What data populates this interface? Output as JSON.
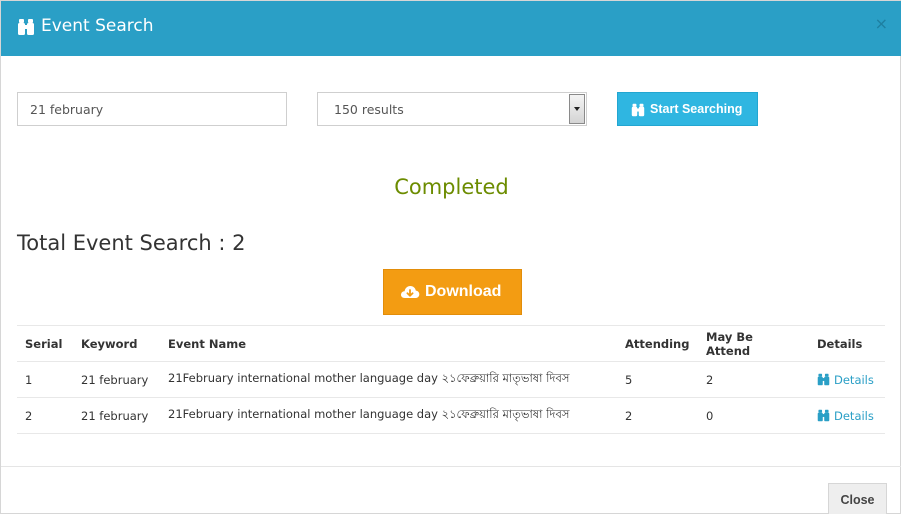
{
  "header": {
    "title": "Event Search",
    "icon": "binoculars-icon",
    "close_label": "×",
    "color": "#2a9fc6"
  },
  "search": {
    "keyword_value": "21 february",
    "results_value": "150 results",
    "button_label": "Start Searching"
  },
  "status": {
    "text": "Completed",
    "color": "#6c8c00"
  },
  "summary": {
    "total_label": "Total Event Search : 2"
  },
  "download": {
    "label": "Download",
    "icon": "cloud-download-icon",
    "color": "#f39c12"
  },
  "table": {
    "columns": [
      "Serial",
      "Keyword",
      "Event Name",
      "Attending",
      "May Be Attend",
      "Details"
    ],
    "rows": [
      {
        "serial": "1",
        "keyword": "21 february",
        "event_name": "21February international mother language day ২১ফেব্রুয়ারি মাতৃভাষা দিবস",
        "attending": "5",
        "maybe": "2",
        "details": "Details"
      },
      {
        "serial": "2",
        "keyword": "21 february",
        "event_name": "21February international mother language day ২১ফেব্রুয়ারি মাতৃভাষা দিবস",
        "attending": "2",
        "maybe": "0",
        "details": "Details"
      }
    ]
  },
  "footer": {
    "close_label": "Close"
  }
}
